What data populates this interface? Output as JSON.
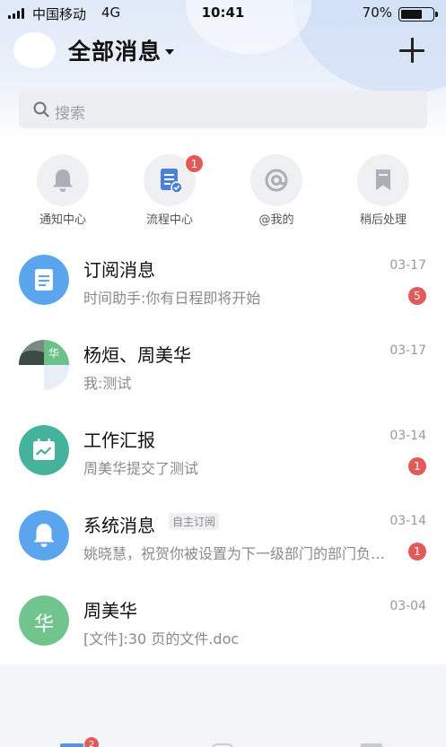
{
  "status_bar": {
    "carrier": "中国移动",
    "network": "4G",
    "time": "10:41",
    "battery_percent": "70%",
    "battery_level": 0.7
  },
  "header": {
    "title": "全部消息"
  },
  "search": {
    "placeholder": "搜索"
  },
  "quick_actions": [
    {
      "label": "通知中心",
      "icon": "bell-icon"
    },
    {
      "label": "流程中心",
      "icon": "process-document-icon",
      "badge": "1"
    },
    {
      "label": "@我的",
      "icon": "at-icon"
    },
    {
      "label": "稍后处理",
      "icon": "bookmark-icon"
    }
  ],
  "messages": [
    {
      "name": "订阅消息",
      "preview": "时间助手:你有日程即将开始",
      "date": "03-17",
      "badge": "5",
      "icon": "subscription-doc-icon",
      "color": "#5aa5ee"
    },
    {
      "name": "杨烜、周美华",
      "preview": "我:测试",
      "date": "03-17",
      "icon": "group-avatar",
      "avatar_char": "华",
      "color": "#6cc08a"
    },
    {
      "name": "工作汇报",
      "preview": "周美华提交了测试",
      "date": "03-14",
      "badge": "1",
      "icon": "report-chart-icon",
      "color": "#45b39b"
    },
    {
      "name": "系统消息",
      "tag": "自主订阅",
      "preview": "姚晓慧，祝贺你被设置为下一级部门的部门负责人",
      "date": "03-14",
      "badge": "1",
      "icon": "system-bell-icon",
      "color": "#5aa5ee"
    },
    {
      "name": "周美华",
      "preview": "[文件]:30 页的文件.doc",
      "date": "03-04",
      "icon": "user-avatar",
      "avatar_char": "华",
      "color": "#72c48e"
    }
  ],
  "tabbar": {
    "badge": "2"
  }
}
